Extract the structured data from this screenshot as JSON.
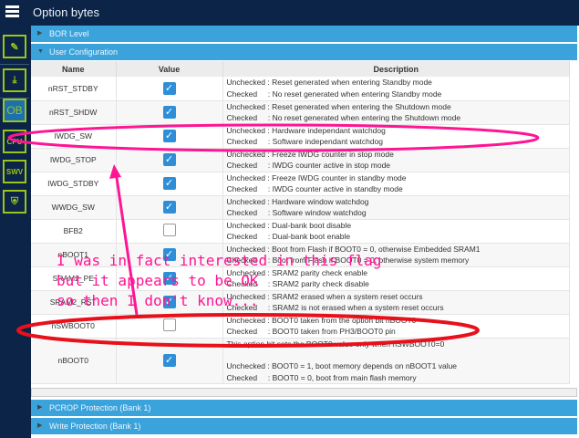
{
  "header": {
    "title": "Option bytes"
  },
  "sidebar": {
    "items": [
      {
        "icon": "edit-icon"
      },
      {
        "icon": "download-icon"
      },
      {
        "label": "OB"
      },
      {
        "label": "CPU"
      },
      {
        "label": "SWV"
      },
      {
        "icon": "shield-icon"
      }
    ]
  },
  "sections": {
    "bor": "BOR Level",
    "user": "User Configuration",
    "pcrop": "PCROP Protection (Bank 1)",
    "wrp": "Write Protection (Bank 1)"
  },
  "table": {
    "headers": [
      "Name",
      "Value",
      "Description"
    ],
    "rows": [
      {
        "name": "nRST_STDBY",
        "checked": true,
        "d1": "Unchecked : Reset generated when entering Standby mode",
        "d2": "Checked     : No reset generated when entering Standby mode"
      },
      {
        "name": "nRST_SHDW",
        "checked": true,
        "d1": "Unchecked : Reset generated when entering the Shutdown mode",
        "d2": "Checked     : No reset generated when entering the Shutdown mode"
      },
      {
        "name": "IWDG_SW",
        "checked": true,
        "d1": "Unchecked : Hardware independant watchdog",
        "d2": "Checked     : Software independant watchdog"
      },
      {
        "name": "IWDG_STOP",
        "checked": true,
        "d1": "Unchecked : Freeze IWDG counter in stop mode",
        "d2": "Checked     : IWDG counter active in stop mode"
      },
      {
        "name": "IWDG_STDBY",
        "checked": true,
        "d1": "Unchecked : Freeze IWDG counter in standby mode",
        "d2": "Checked     : IWDG counter active in standby mode"
      },
      {
        "name": "WWDG_SW",
        "checked": true,
        "d1": "Unchecked : Hardware window watchdog",
        "d2": "Checked     : Software window watchdog"
      },
      {
        "name": "BFB2",
        "checked": false,
        "d1": "Unchecked : Dual-bank boot disable",
        "d2": "Checked     : Dual-bank boot enable"
      },
      {
        "name": "nBOOT1",
        "checked": true,
        "d1": "Unchecked : Boot from Flash if BOOT0 = 0, otherwise Embedded SRAM1",
        "d2": "Checked     : Boot from Flash if BOOT0 = 0, otherwise system memory"
      },
      {
        "name": "SRAM2_PE",
        "checked": true,
        "d1": "Unchecked : SRAM2 parity check enable",
        "d2": "Checked     : SRAM2 parity check disable"
      },
      {
        "name": "SRAM2_RST",
        "checked": true,
        "d1": "Unchecked : SRAM2 erased when a system reset occurs",
        "d2": "Checked     : SRAM2 is not erased when a system reset occurs"
      },
      {
        "name": "nSWBOOT0",
        "checked": false,
        "d1": "Unchecked : BOOT0 taken from the option bit nBOOT0",
        "d2": "Checked     : BOOT0 taken from PH3/BOOT0 pin"
      },
      {
        "name": "nBOOT0",
        "checked": true,
        "d0": "This option bit sets the BOOT0 value only when nSWBOOT0=0",
        "d1": "Unchecked : BOOT0 = 1, boot memory depends on nBOOT1 value",
        "d2": "Checked     : BOOT0 = 0, boot from main flash memory"
      }
    ]
  },
  "annotation": {
    "lines": [
      "I was in fact interested in this flag",
      "but it appears to be OK",
      "so then I don't know..."
    ],
    "pink": "#ff1493",
    "red": "#e8101a"
  }
}
